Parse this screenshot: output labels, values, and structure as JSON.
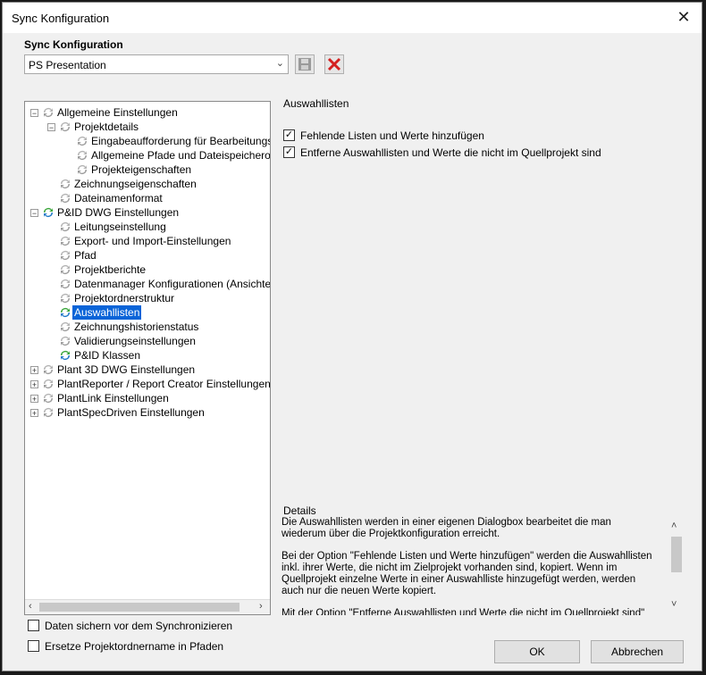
{
  "window": {
    "title": "Sync Konfiguration",
    "close_glyph": "✕"
  },
  "config": {
    "section_label": "Sync Konfiguration",
    "selected_value": "PS Presentation",
    "save_icon": "save-icon",
    "delete_icon": "delete-icon"
  },
  "tree": {
    "items": [
      {
        "label": "Allgemeine Einstellungen"
      },
      {
        "label": "Projektdetails"
      },
      {
        "label": "Eingabeaufforderung für Bearbeitungsver"
      },
      {
        "label": "Allgemeine Pfade und Dateispeicherorte"
      },
      {
        "label": "Projekteigenschaften"
      },
      {
        "label": "Zeichnungseigenschaften"
      },
      {
        "label": "Dateinamenformat"
      },
      {
        "label": "P&ID DWG Einstellungen"
      },
      {
        "label": "Leitungseinstellung"
      },
      {
        "label": "Export- und Import-Einstellungen"
      },
      {
        "label": "Pfad"
      },
      {
        "label": "Projektberichte"
      },
      {
        "label": "Datenmanager Konfigurationen (Ansichten)"
      },
      {
        "label": "Projektordnerstruktur"
      },
      {
        "label": "Auswahllisten"
      },
      {
        "label": "Zeichnungshistorienstatus"
      },
      {
        "label": "Validierungseinstellungen"
      },
      {
        "label": "P&ID Klassen"
      },
      {
        "label": "Plant 3D DWG Einstellungen"
      },
      {
        "label": "PlantReporter / Report Creator Einstellungen"
      },
      {
        "label": "PlantLink Einstellungen"
      },
      {
        "label": "PlantSpecDriven Einstellungen"
      }
    ]
  },
  "right": {
    "title": "Auswahllisten",
    "options": [
      {
        "label": "Fehlende Listen und Werte hinzufügen",
        "checked": true
      },
      {
        "label": "Entferne Auswahllisten und Werte die nicht im Quellprojekt sind",
        "checked": true
      }
    ]
  },
  "details": {
    "title": "Details",
    "p1": "Die Auswahllisten werden in einer eigenen Dialogbox bearbeitet die man wiederum über die Projektkonfiguration erreicht.",
    "p2": "Bei der Option \"Fehlende Listen und Werte hinzufügen\" werden die Auswahllisten inkl. ihrer Werte, die nicht im Zielprojekt vorhanden sind, kopiert. Wenn im Quellprojekt einzelne Werte in einer Auswahlliste hinzugefügt werden, werden auch nur die neuen Werte kopiert.",
    "p3": "Mit der Option \"Entferne Auswahllisten und Werte die nicht im Quellprojekt sind\""
  },
  "bottom": {
    "backup_label": "Daten sichern vor dem Synchronizieren",
    "replace_label": "Ersetze Projektordnername in Pfaden",
    "ok_label": "OK",
    "cancel_label": "Abbrechen"
  },
  "colors": {
    "selection": "#0a64d8",
    "sync_green": "#3aa63a",
    "sync_blue": "#1e78c8",
    "delete_red": "#d42020"
  }
}
